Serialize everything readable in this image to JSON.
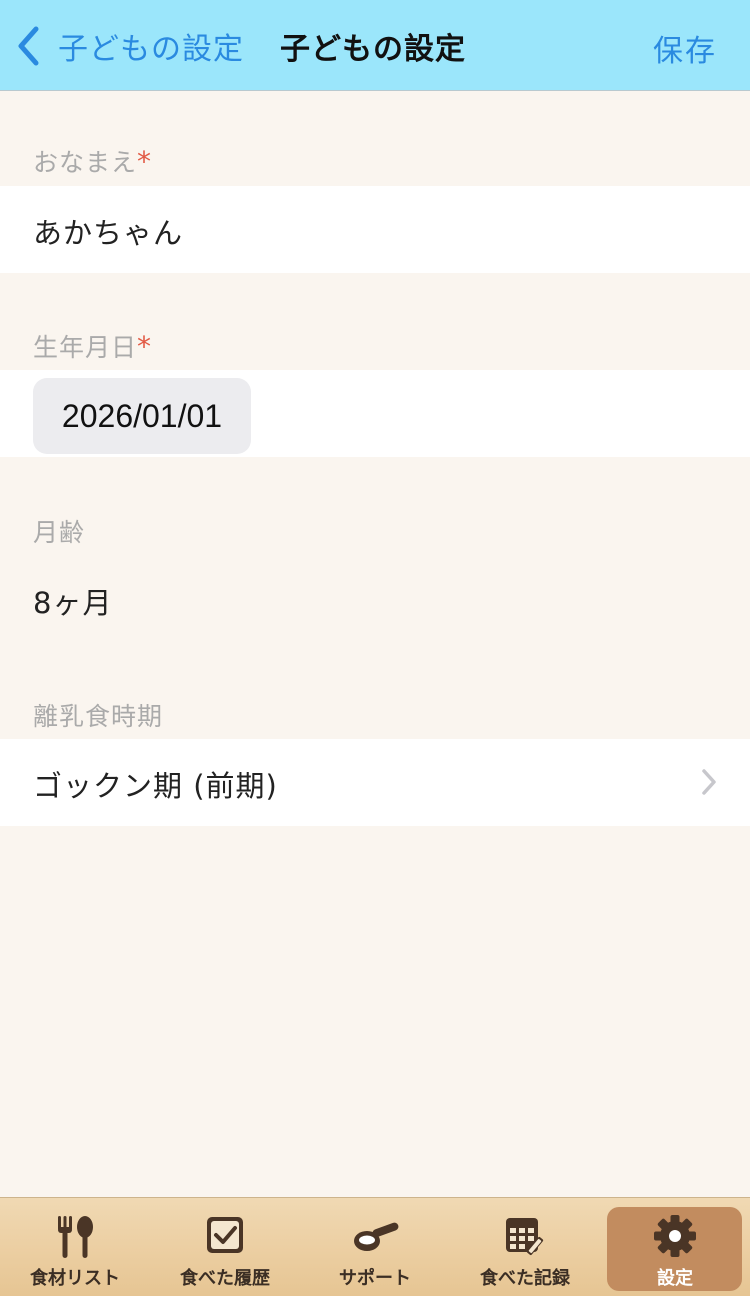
{
  "nav": {
    "back_label": "子どもの設定",
    "title": "子どもの設定",
    "save_label": "保存"
  },
  "form": {
    "name": {
      "label": "おなまえ",
      "required_mark": "*",
      "value": "あかちゃん"
    },
    "birthday": {
      "label": "生年月日",
      "required_mark": "*",
      "value": "2026/01/01"
    },
    "age": {
      "label": "月齢",
      "value": "8ヶ月"
    },
    "stage": {
      "label": "離乳食時期",
      "value": "ゴックン期 (前期)"
    }
  },
  "tabs": [
    {
      "label": "食材リスト",
      "icon": "fork-spoon-icon",
      "active": false
    },
    {
      "label": "食べた履歴",
      "icon": "checkbox-icon",
      "active": false
    },
    {
      "label": "サポート",
      "icon": "spoon-icon",
      "active": false
    },
    {
      "label": "食べた記録",
      "icon": "calendar-pencil-icon",
      "active": false
    },
    {
      "label": "設定",
      "icon": "gear-icon",
      "active": true
    }
  ],
  "colors": {
    "nav_bg": "#9be6fb",
    "link": "#2a8ae0",
    "required": "#e25a45",
    "page_bg": "#faf5ef",
    "tab_active": "#c28c5f"
  }
}
